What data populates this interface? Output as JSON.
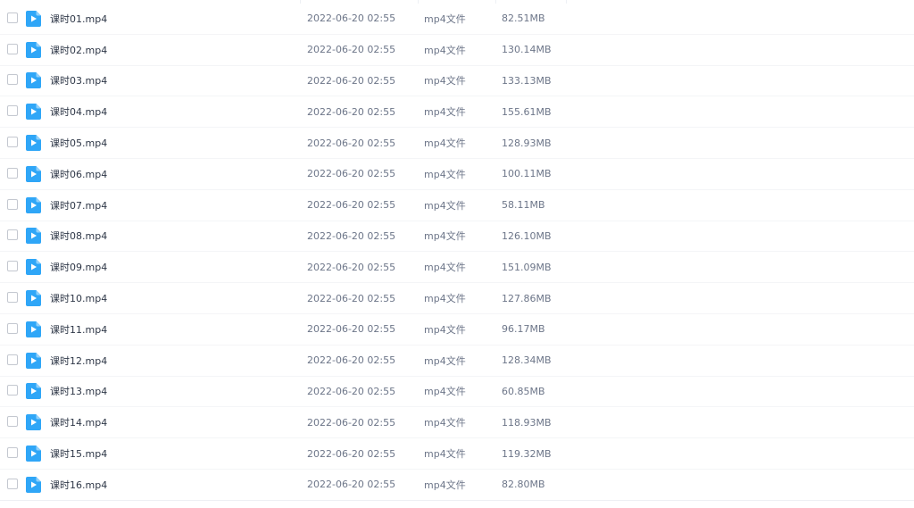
{
  "file_list": {
    "icon": "video-file-icon",
    "accent_color": "#2fa6f7",
    "rows": [
      {
        "name": "课时01.mp4",
        "modified": "2022-06-20 02:55",
        "type": "mp4文件",
        "size": "82.51MB"
      },
      {
        "name": "课时02.mp4",
        "modified": "2022-06-20 02:55",
        "type": "mp4文件",
        "size": "130.14MB"
      },
      {
        "name": "课时03.mp4",
        "modified": "2022-06-20 02:55",
        "type": "mp4文件",
        "size": "133.13MB"
      },
      {
        "name": "课时04.mp4",
        "modified": "2022-06-20 02:55",
        "type": "mp4文件",
        "size": "155.61MB"
      },
      {
        "name": "课时05.mp4",
        "modified": "2022-06-20 02:55",
        "type": "mp4文件",
        "size": "128.93MB"
      },
      {
        "name": "课时06.mp4",
        "modified": "2022-06-20 02:55",
        "type": "mp4文件",
        "size": "100.11MB"
      },
      {
        "name": "课时07.mp4",
        "modified": "2022-06-20 02:55",
        "type": "mp4文件",
        "size": "58.11MB"
      },
      {
        "name": "课时08.mp4",
        "modified": "2022-06-20 02:55",
        "type": "mp4文件",
        "size": "126.10MB"
      },
      {
        "name": "课时09.mp4",
        "modified": "2022-06-20 02:55",
        "type": "mp4文件",
        "size": "151.09MB"
      },
      {
        "name": "课时10.mp4",
        "modified": "2022-06-20 02:55",
        "type": "mp4文件",
        "size": "127.86MB"
      },
      {
        "name": "课时11.mp4",
        "modified": "2022-06-20 02:55",
        "type": "mp4文件",
        "size": "96.17MB"
      },
      {
        "name": "课时12.mp4",
        "modified": "2022-06-20 02:55",
        "type": "mp4文件",
        "size": "128.34MB"
      },
      {
        "name": "课时13.mp4",
        "modified": "2022-06-20 02:55",
        "type": "mp4文件",
        "size": "60.85MB"
      },
      {
        "name": "课时14.mp4",
        "modified": "2022-06-20 02:55",
        "type": "mp4文件",
        "size": "118.93MB"
      },
      {
        "name": "课时15.mp4",
        "modified": "2022-06-20 02:55",
        "type": "mp4文件",
        "size": "119.32MB"
      },
      {
        "name": "课时16.mp4",
        "modified": "2022-06-20 02:55",
        "type": "mp4文件",
        "size": "82.80MB"
      }
    ]
  }
}
